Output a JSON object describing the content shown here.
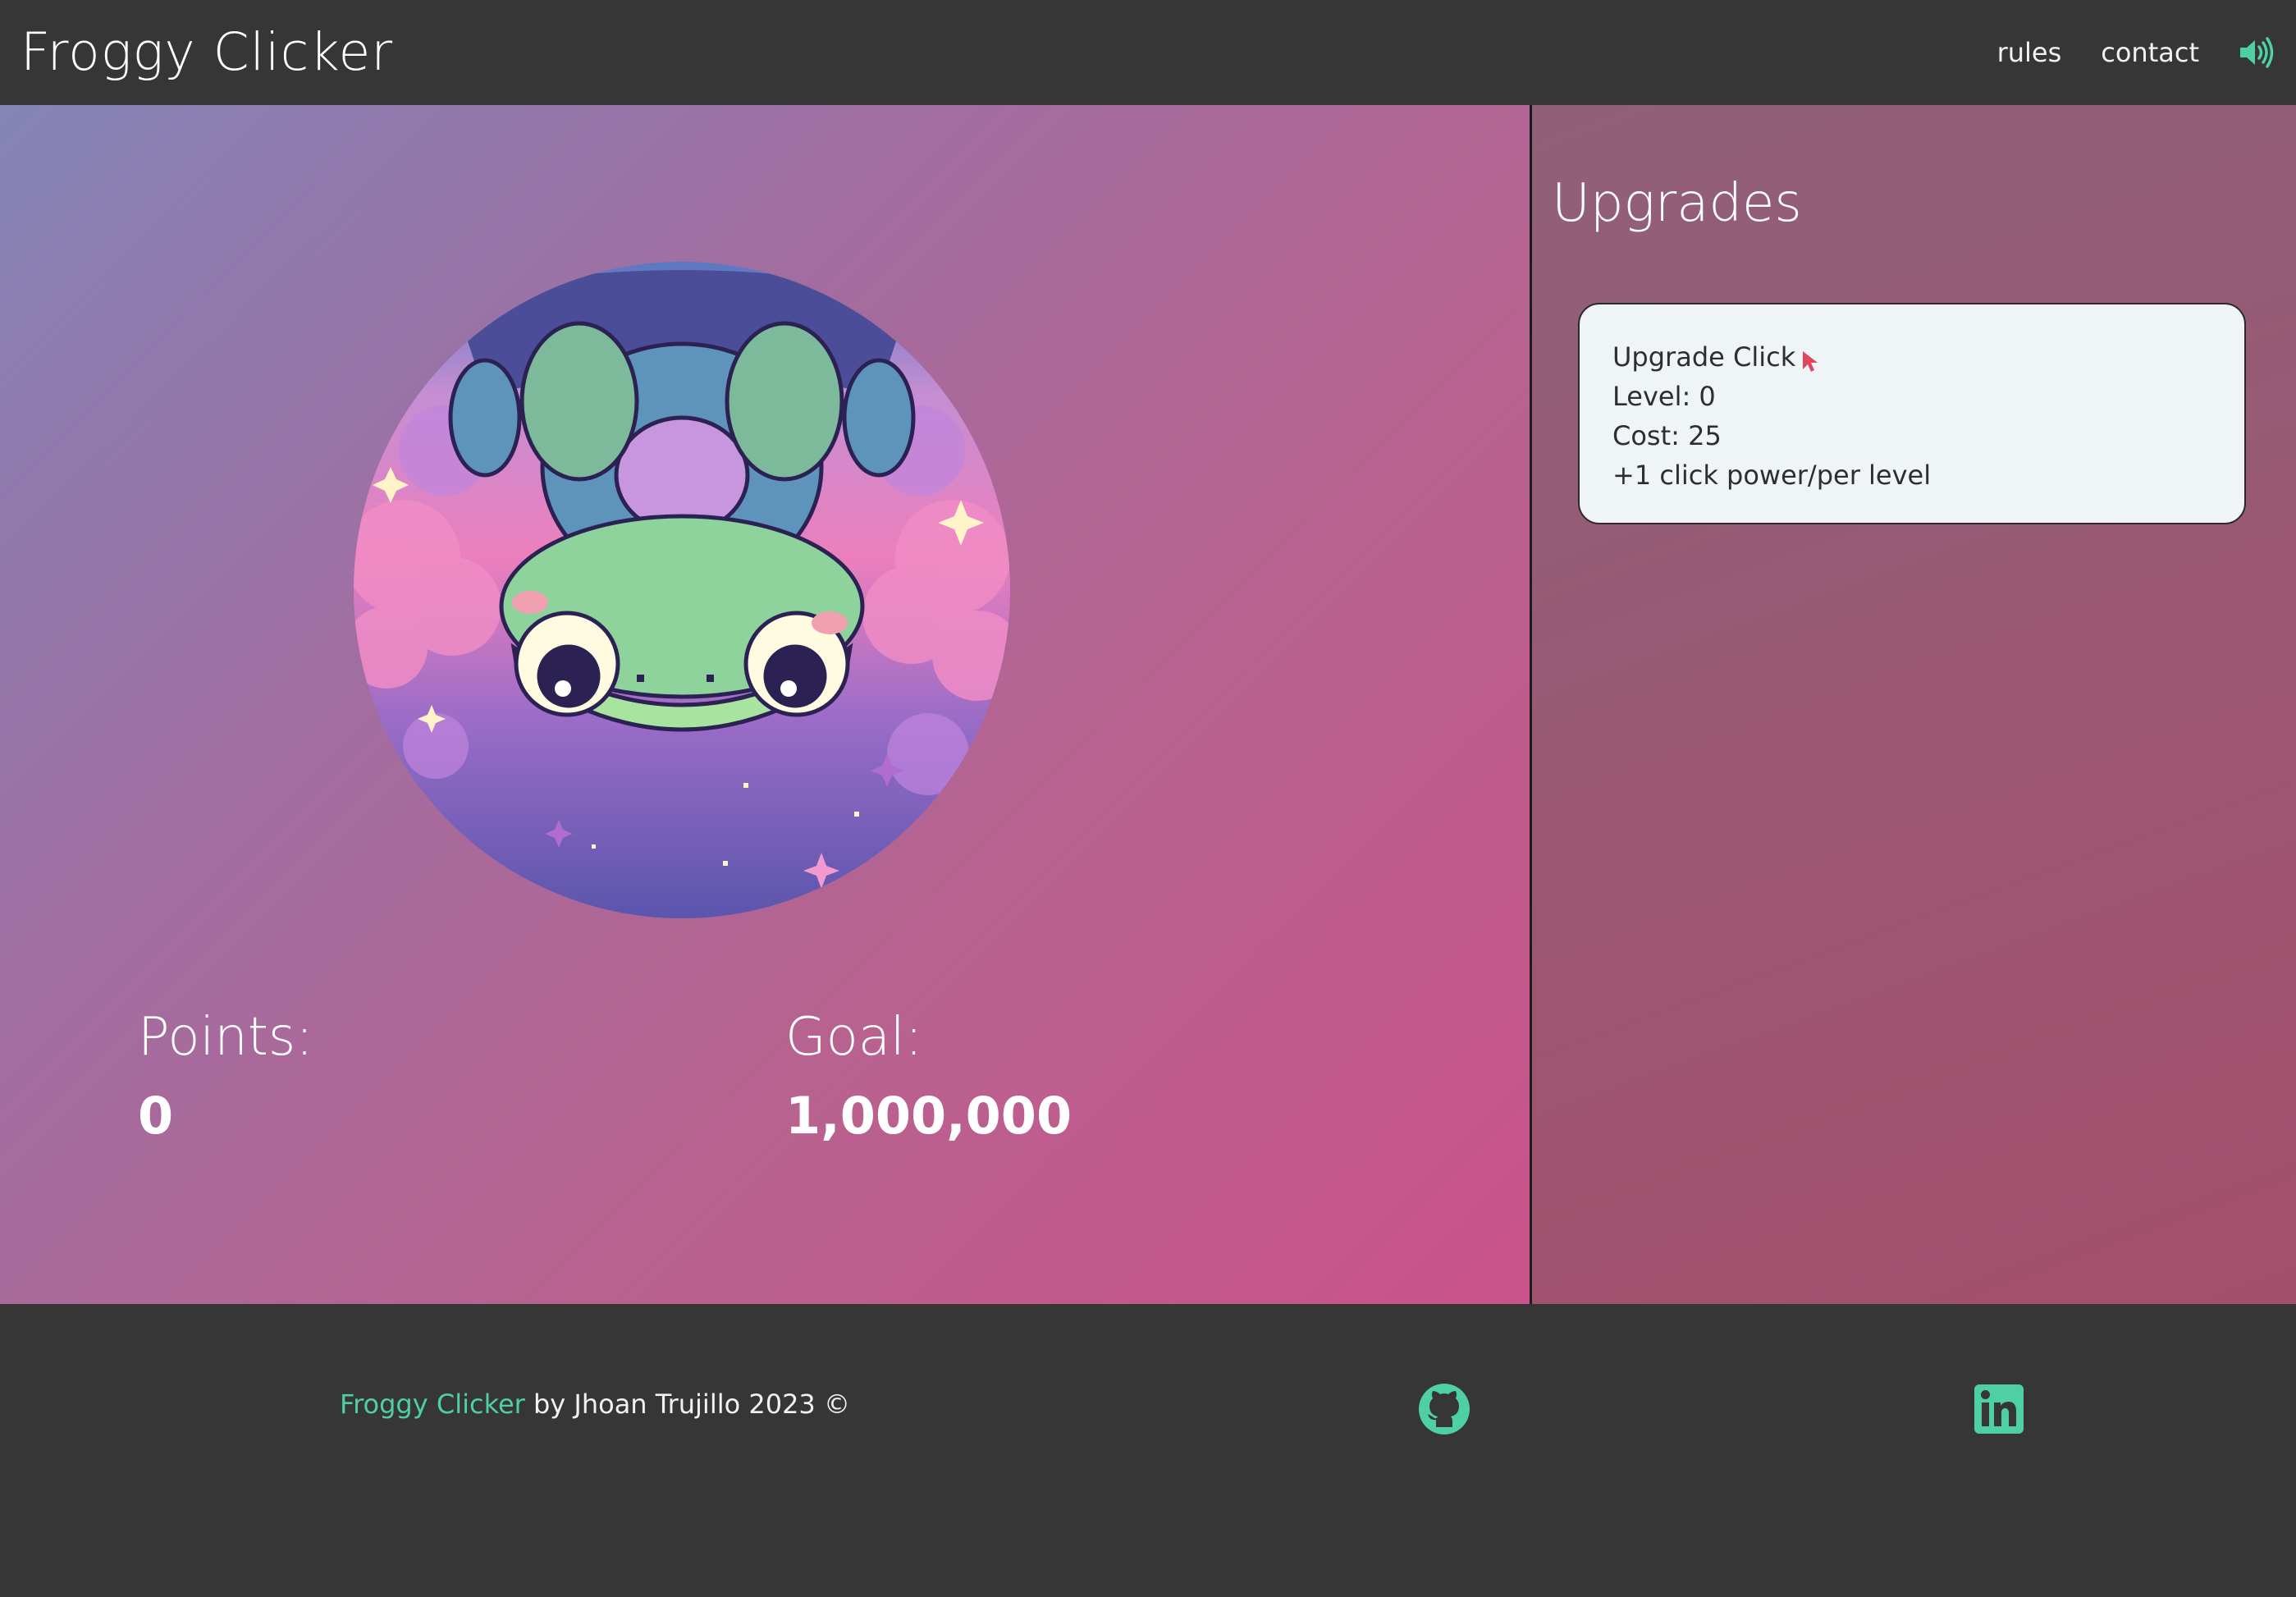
{
  "header": {
    "title": "Froggy Clicker",
    "nav": {
      "rules": "rules",
      "contact": "contact"
    },
    "sound_icon": "speaker-volume-icon"
  },
  "game": {
    "image": "pixel-frog-upside-down",
    "points_label": "Points:",
    "points_value": "0",
    "goal_label": "Goal:",
    "goal_value": "1,000,000"
  },
  "upgrades": {
    "title": "Upgrades",
    "items": [
      {
        "name": "Upgrade Click",
        "icon": "cursor-icon",
        "level": "Level: 0",
        "cost": "Cost: 25",
        "effect": "+1 click power/per level"
      }
    ]
  },
  "footer": {
    "brand": "Froggy Clicker",
    "credit": " by Jhoan Trujillo 2023 ©",
    "links": [
      "github-icon",
      "linkedin-icon"
    ]
  },
  "colors": {
    "accent": "#4fcfa6",
    "bar": "#363636",
    "card": "#eff4f7",
    "cursor": "#e0475e"
  }
}
